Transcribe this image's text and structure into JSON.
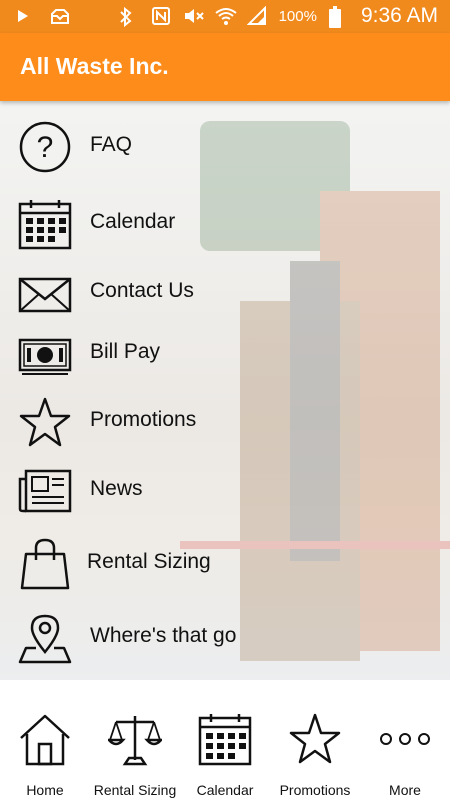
{
  "status_bar": {
    "battery": "100%",
    "time": "9:36 AM"
  },
  "app_bar": {
    "title": "All Waste Inc."
  },
  "menu": {
    "items": [
      {
        "label": "FAQ",
        "icon": "question-icon"
      },
      {
        "label": "Calendar",
        "icon": "calendar-icon"
      },
      {
        "label": "Contact Us",
        "icon": "envelope-icon"
      },
      {
        "label": "Bill Pay",
        "icon": "money-icon"
      },
      {
        "label": "Promotions",
        "icon": "star-icon"
      },
      {
        "label": "News",
        "icon": "newspaper-icon"
      },
      {
        "label": "Rental Sizing",
        "icon": "shopping-bag-icon"
      },
      {
        "label": "Where's that go",
        "icon": "map-pin-icon"
      }
    ]
  },
  "bottom_nav": {
    "items": [
      {
        "label": "Home",
        "icon": "home-icon"
      },
      {
        "label": "Rental Sizing",
        "icon": "scale-icon"
      },
      {
        "label": "Calendar",
        "icon": "calendar-icon"
      },
      {
        "label": "Promotions",
        "icon": "star-icon"
      },
      {
        "label": "More",
        "icon": "more-icon"
      }
    ]
  },
  "colors": {
    "accent": "#fd8c1a",
    "status_bar": "#f18a1c"
  }
}
